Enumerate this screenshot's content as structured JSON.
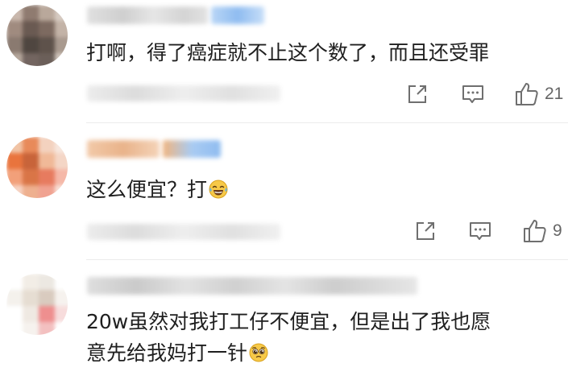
{
  "comments": [
    {
      "text": "打啊，得了癌症就不止这个数了，而且还受罪",
      "like_count": "21",
      "icons": {
        "share": "share-out-icon",
        "reply": "comment-icon",
        "like": "thumbs-up-icon"
      }
    },
    {
      "text": "这么便宜？打",
      "emoji": "laughing-tears-emoji",
      "like_count": "9",
      "icons": {
        "share": "share-out-icon",
        "reply": "comment-icon",
        "like": "thumbs-up-icon"
      }
    },
    {
      "text_line1": "20w虽然对我打工仔不便宜，但是出了我也愿",
      "text_line2": "意先给我妈打一针",
      "emoji": "pleading-face-emoji"
    }
  ],
  "colors": {
    "icon_gray": "#6f6f6f",
    "text": "#1f1f1f",
    "count": "#666666",
    "name_blue": "#9fc6f2",
    "name_orange": "#f2b88a"
  }
}
